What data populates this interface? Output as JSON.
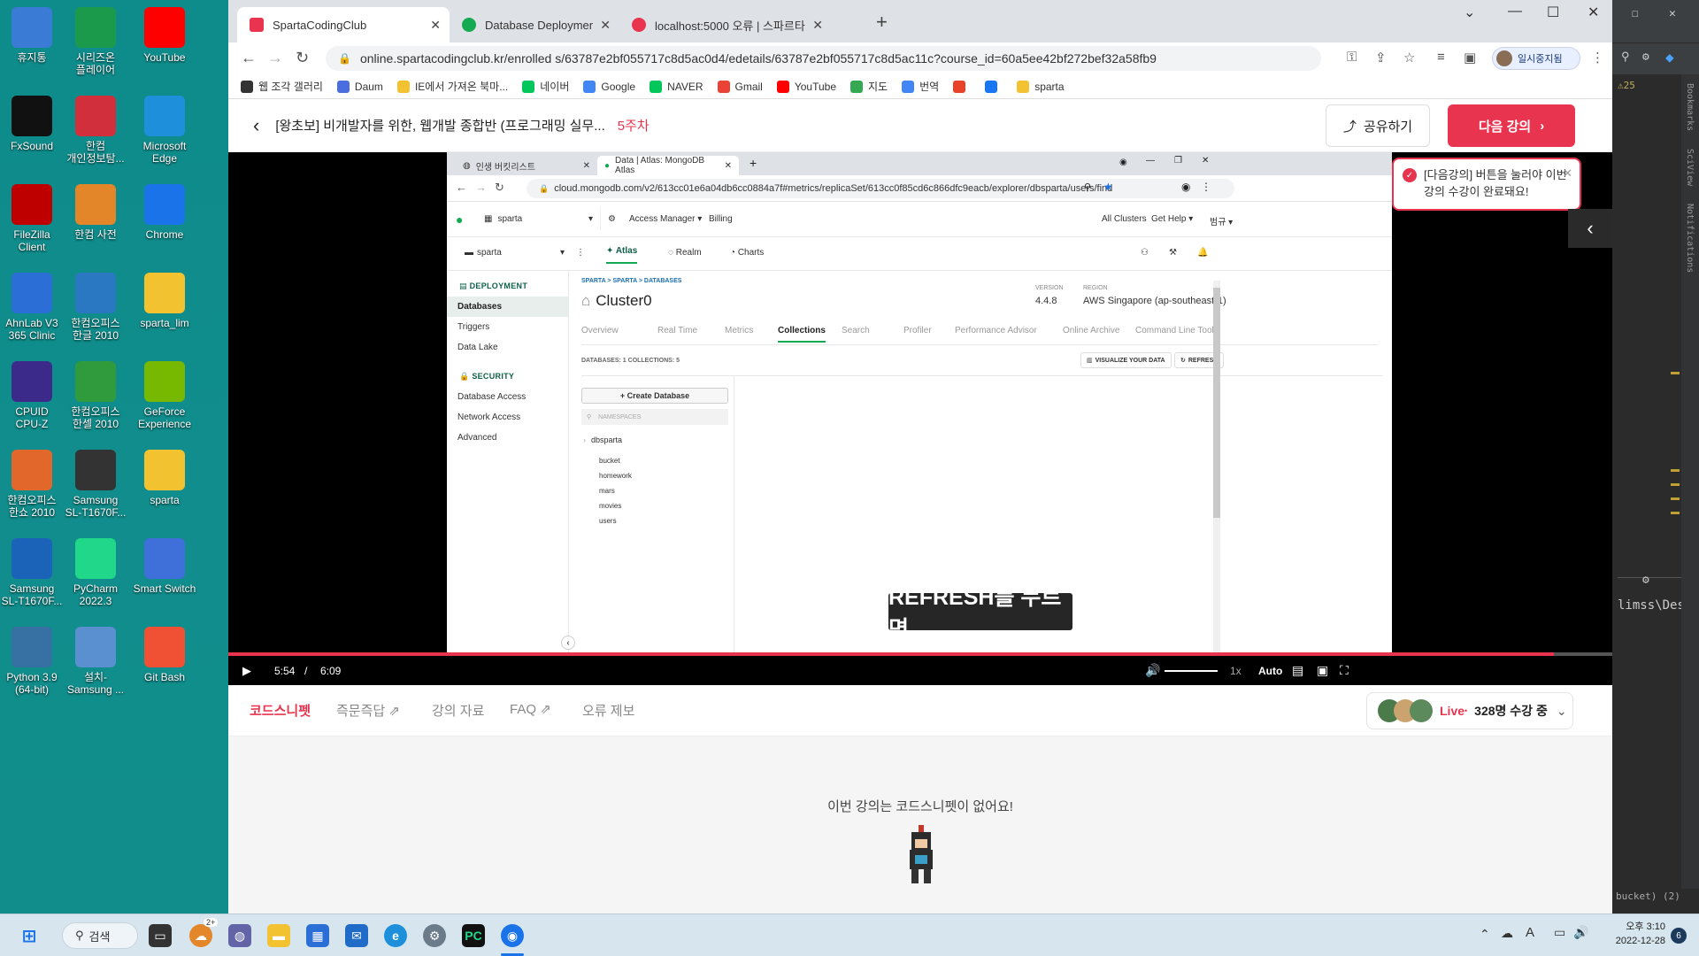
{
  "desktop": {
    "icons": [
      {
        "label": "휴지통",
        "color": "#3a7bd5"
      },
      {
        "label": "시리즈온\n플레이어",
        "color": "#1c9a4b"
      },
      {
        "label": "YouTube",
        "color": "#ff0000"
      },
      {
        "label": "FxSound",
        "color": "#111111"
      },
      {
        "label": "한컴\n개인정보탐...",
        "color": "#d22f3c"
      },
      {
        "label": "Microsoft\nEdge",
        "color": "#1d8fdb"
      },
      {
        "label": "FileZilla\nClient",
        "color": "#bf0000"
      },
      {
        "label": "한컴 사전",
        "color": "#e3862a"
      },
      {
        "label": "Chrome",
        "color": "#1a73e8"
      },
      {
        "label": "AhnLab V3\n365 Clinic",
        "color": "#2b6fd6"
      },
      {
        "label": "한컴오피스\n한글 2010",
        "color": "#2b78c2"
      },
      {
        "label": "sparta_lim",
        "color": "#f2c230"
      },
      {
        "label": "CPUID\nCPU-Z",
        "color": "#3b2a8a"
      },
      {
        "label": "한컴오피스\n한셀 2010",
        "color": "#2f9b3c"
      },
      {
        "label": "GeForce\nExperience",
        "color": "#76b900"
      },
      {
        "label": "한컴오피스\n한쇼 2010",
        "color": "#e2672a"
      },
      {
        "label": "Samsung\nSL-T1670F...",
        "color": "#333333"
      },
      {
        "label": "sparta",
        "color": "#f2c230"
      },
      {
        "label": "Samsung\nSL-T1670F...",
        "color": "#1b63b8"
      },
      {
        "label": "PyCharm\n2022.3",
        "color": "#21d789"
      },
      {
        "label": "Smart Switch",
        "color": "#3f6fd8"
      },
      {
        "label": "Python 3.9\n(64-bit)",
        "color": "#3771a4"
      },
      {
        "label": "설치-\nSamsung ...",
        "color": "#5a8fd0"
      },
      {
        "label": "Git Bash",
        "color": "#f05033"
      }
    ]
  },
  "browser": {
    "tabs": [
      {
        "title": "SpartaCodingClub",
        "active": true,
        "color": "#e8344e"
      },
      {
        "title": "Database Deployments | Cloud",
        "active": false,
        "color": "#13aa52"
      },
      {
        "title": "localhost:5000 오류 | 스파르타",
        "active": false,
        "color": "#e8344e"
      }
    ],
    "url": "online.spartacodingclub.kr/enrolled s/63787e2bf055717c8d5ac0d4/edetails/63787e2bf055717c8d5ac11c?course_id=60a5ee42bf272bef32a58fb9",
    "profile_label": "일시중지됨",
    "bookmarks": [
      {
        "label": "웹 조각 갤러리",
        "color": "#333333"
      },
      {
        "label": "Daum",
        "color": "#4a6ee0"
      },
      {
        "label": "IE에서 가져온 북마...",
        "color": "#f2c230"
      },
      {
        "label": "네이버",
        "color": "#03c75a"
      },
      {
        "label": "Google",
        "color": "#4285f4"
      },
      {
        "label": "NAVER",
        "color": "#03c75a"
      },
      {
        "label": "Gmail",
        "color": "#ea4335"
      },
      {
        "label": "YouTube",
        "color": "#ff0000"
      },
      {
        "label": "지도",
        "color": "#34a853"
      },
      {
        "label": "번역",
        "color": "#4285f4"
      },
      {
        "label": "",
        "color": "#e8432a"
      },
      {
        "label": "",
        "color": "#1877f2"
      },
      {
        "label": "sparta",
        "color": "#f2c230"
      }
    ]
  },
  "lecture": {
    "title": "[왕초보] 비개발자를 위한, 웹개발 종합반 (프로그래밍 실무...",
    "week": "5주차",
    "share_label": "공유하기",
    "next_label": "다음 강의",
    "toast_text": "[다음강의] 버튼을 눌러야 이번 강의 수강이 완료돼요!"
  },
  "video": {
    "tabs": [
      "인생 버킷리스트",
      "Data | Atlas: MongoDB Atlas"
    ],
    "url": "cloud.mongodb.com/v2/613cc01e6a04db6cc0884a7f#metrics/replicaSet/613cc0f85cd6c866dfc9eacb/explorer/dbsparta/users/find",
    "org": "sparta",
    "access_manager": "Access Manager",
    "billing": "Billing",
    "all_clusters": "All Clusters",
    "get_help": "Get Help",
    "user_menu": "범규",
    "project": "sparta",
    "nav": [
      "Atlas",
      "Realm",
      "Charts"
    ],
    "sidebar": {
      "deployment": "DEPLOYMENT",
      "deploy_items": [
        "Databases",
        "Triggers",
        "Data Lake"
      ],
      "security": "SECURITY",
      "security_items": [
        "Database Access",
        "Network Access",
        "Advanced"
      ]
    },
    "breadcrumb": "SPARTA > SPARTA > DATABASES",
    "cluster": "Cluster0",
    "version_label": "VERSION",
    "version": "4.4.8",
    "region_label": "REGION",
    "region": "AWS Singapore (ap-southeast-1)",
    "cluster_tabs": [
      "Overview",
      "Real Time",
      "Metrics",
      "Collections",
      "Search",
      "Profiler",
      "Performance Advisor",
      "Online Archive",
      "Command Line Tools"
    ],
    "counts": "DATABASES: 1   COLLECTIONS: 5",
    "visualize": "VISUALIZE YOUR DATA",
    "refresh": "REFRESH",
    "create_db": "+ Create Database",
    "namespaces": "NAMESPACES",
    "db": "dbsparta",
    "collections": [
      "bucket",
      "homework",
      "mars",
      "movies",
      "users"
    ],
    "subtitle": "REFRESH를 누르면"
  },
  "player": {
    "current": "5:54",
    "sep": "/",
    "duration": "6:09",
    "progress": 0.958,
    "speed": "1x",
    "quality": "Auto"
  },
  "page_tabs": [
    "코드스니펫",
    "즉문즉답",
    "강의 자료",
    "FAQ",
    "오류 제보"
  ],
  "live": {
    "label": "Live",
    "count": "328명 수강 중"
  },
  "snippet_empty": "이번 강의는 코드스니펫이 없어요!",
  "ide": {
    "warn": "25",
    "path": "limss\\Des",
    "bottom": "bucket) (2)",
    "side": [
      "Bookmarks",
      "SciView",
      "Notifications"
    ]
  },
  "taskbar": {
    "search": "검색",
    "badge": "2+",
    "ampm": "오후 3:10",
    "date": "2022-12-28",
    "notif": "6"
  }
}
